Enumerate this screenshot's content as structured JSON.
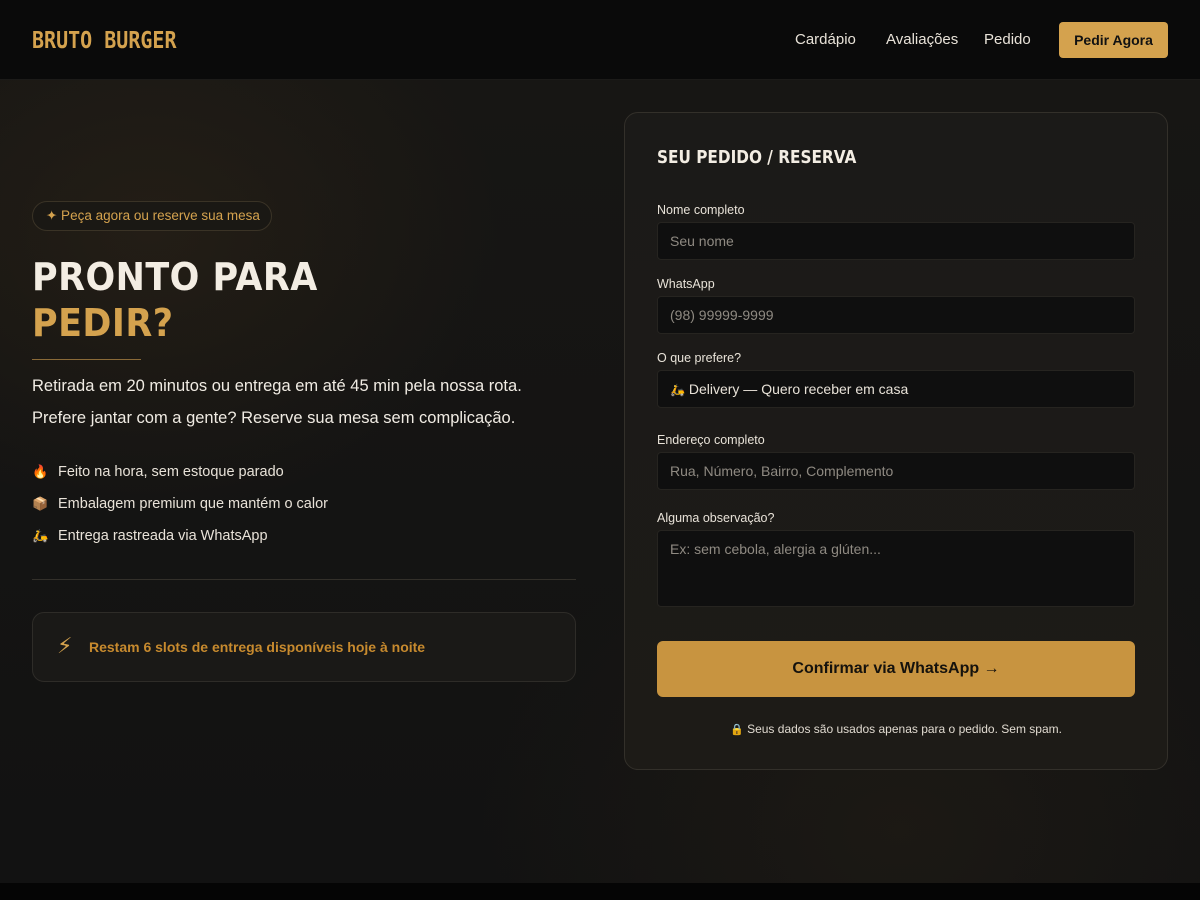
{
  "brand": {
    "name": "BRUTO BURGER",
    "accent": "#d4a24e"
  },
  "nav": {
    "links": [
      "Cardápio",
      "Avaliações",
      "Pedido"
    ],
    "cta": "Pedir Agora"
  },
  "hero": {
    "badge": "✦ Peça agora ou reserve sua mesa",
    "title_line1": "PRONTO PARA",
    "title_line2": "PEDIR?",
    "lead1": "Retirada em 20 minutos ou entrega em até 45 min pela nossa rota.",
    "lead2": "Prefere jantar com a gente? Reserve sua mesa sem complicação.",
    "features": [
      {
        "icon": "fire-icon",
        "glyph": "🔥",
        "text": "Feito na hora, sem estoque parado"
      },
      {
        "icon": "package-icon",
        "glyph": "📦",
        "text": "Embalagem premium que mantém o calor"
      },
      {
        "icon": "scooter-icon",
        "glyph": "🛵",
        "text": "Entrega rastreada via WhatsApp"
      }
    ],
    "slots_icon": "⚡",
    "slots_text": "Restam 6 slots de entrega disponíveis hoje à noite"
  },
  "form": {
    "title": "SEU PEDIDO / RESERVA",
    "name_label": "Nome completo",
    "name_placeholder": "Seu nome",
    "whatsapp_label": "WhatsApp",
    "whatsapp_placeholder": "(98) 99999-9999",
    "preference_label": "O que prefere?",
    "preference_glyph": "🛵",
    "preference_value": "Delivery — Quero receber em casa",
    "address_label": "Endereço completo",
    "address_placeholder": "Rua, Número, Bairro, Complemento",
    "notes_label": "Alguma observação?",
    "notes_placeholder": "Ex: sem cebola, alergia a glúten...",
    "submit_label": "Confirmar via WhatsApp →",
    "privacy_glyph": "🔒",
    "privacy_text": "Seus dados são usados apenas para o pedido. Sem spam."
  }
}
